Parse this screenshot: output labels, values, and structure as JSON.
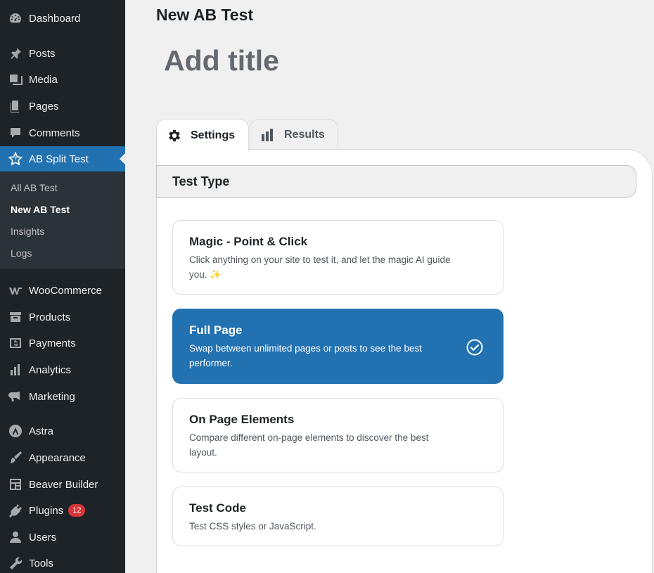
{
  "sidebar": {
    "menu": [
      {
        "label": "Dashboard",
        "icon": "dashboard-icon"
      },
      {
        "label": "Posts",
        "icon": "pin-icon"
      },
      {
        "label": "Media",
        "icon": "media-icon"
      },
      {
        "label": "Pages",
        "icon": "pages-icon"
      },
      {
        "label": "Comments",
        "icon": "comment-icon"
      },
      {
        "label": "AB Split Test",
        "icon": "star-icon"
      },
      {
        "label": "WooCommerce",
        "icon": "woocommerce-icon"
      },
      {
        "label": "Products",
        "icon": "archive-icon"
      },
      {
        "label": "Payments",
        "icon": "dollar-icon"
      },
      {
        "label": "Analytics",
        "icon": "bar-chart-icon"
      },
      {
        "label": "Marketing",
        "icon": "megaphone-icon"
      },
      {
        "label": "Astra",
        "icon": "astra-icon"
      },
      {
        "label": "Appearance",
        "icon": "brush-icon"
      },
      {
        "label": "Beaver Builder",
        "icon": "layout-icon"
      },
      {
        "label": "Plugins",
        "icon": "plug-icon",
        "badge": "12"
      },
      {
        "label": "Users",
        "icon": "user-icon"
      },
      {
        "label": "Tools",
        "icon": "wrench-icon"
      }
    ],
    "submenu": [
      {
        "label": "All AB Test"
      },
      {
        "label": "New AB Test"
      },
      {
        "label": "Insights"
      },
      {
        "label": "Logs"
      }
    ]
  },
  "header": {
    "title": "New AB Test",
    "title_placeholder": "Add title"
  },
  "tabs": [
    {
      "label": "Settings",
      "icon": "gear-icon"
    },
    {
      "label": "Results",
      "icon": "bar-chart-icon"
    }
  ],
  "test_type": {
    "heading": "Test Type",
    "options": [
      {
        "title": "Magic - Point & Click",
        "description": "Click anything on your site to test it, and let the magic AI guide you. ✨"
      },
      {
        "title": "Full Page",
        "description": "Swap between unlimited pages or posts to see the best performer."
      },
      {
        "title": "On Page Elements",
        "description": "Compare different on-page elements to discover the best layout."
      },
      {
        "title": "Test Code",
        "description": "Test CSS styles or JavaScript."
      }
    ]
  },
  "colors": {
    "accent": "#2271b1",
    "sidebar_bg": "#1d2327",
    "badge": "#d63638"
  }
}
